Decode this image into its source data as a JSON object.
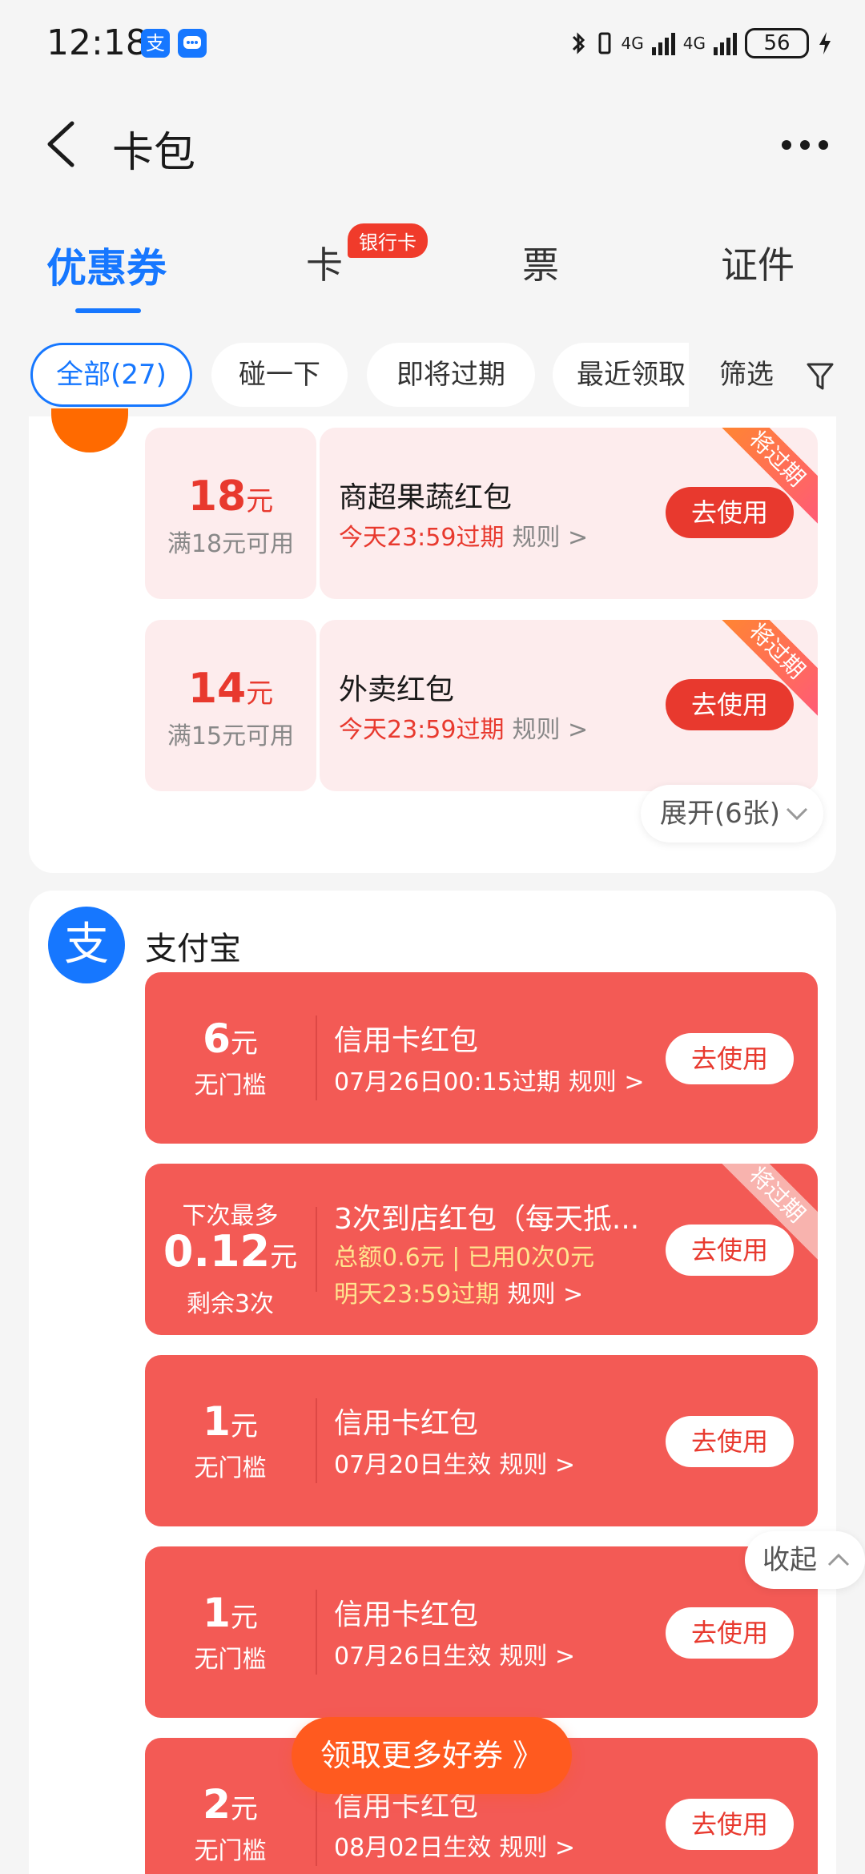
{
  "status_bar": {
    "time": "12:18",
    "app_icon_1": "支",
    "network_1": "4G",
    "network_2": "4G",
    "battery": "56"
  },
  "header": {
    "title": "卡包"
  },
  "tabs": [
    {
      "label": "优惠券",
      "active": true
    },
    {
      "label": "卡",
      "badge": "银行卡"
    },
    {
      "label": "票"
    },
    {
      "label": "证件"
    }
  ],
  "chips": [
    {
      "label": "全部(27)",
      "active": true
    },
    {
      "label": "碰一下"
    },
    {
      "label": "即将过期"
    },
    {
      "label": "最近领取"
    }
  ],
  "filter_label": "筛选",
  "group1": {
    "coupons": [
      {
        "amount": "18",
        "unit": "元",
        "condition": "满18元可用",
        "name": "商超果蔬红包",
        "expire": "今天23:59过期",
        "rule": "规则 >",
        "button": "去使用",
        "ribbon": "将过期"
      },
      {
        "amount": "14",
        "unit": "元",
        "condition": "满15元可用",
        "name": "外卖红包",
        "expire": "今天23:59过期",
        "rule": "规则 >",
        "button": "去使用",
        "ribbon": "将过期"
      }
    ],
    "expand_label": "展开(6张)"
  },
  "group2": {
    "logo": "支",
    "title": "支付宝",
    "coupons": [
      {
        "amount": "6",
        "unit": "元",
        "condition": "无门槛",
        "name": "信用卡红包",
        "expire": "07月26日00:15过期",
        "rule": "规则 >",
        "button": "去使用"
      },
      {
        "top": "下次最多",
        "amount": "0.12",
        "unit": "元",
        "bottom": "剩余3次",
        "name": "3次到店红包（每天抵...",
        "line2": "总额0.6元 | 已用0次0元",
        "expire": "明天23:59过期",
        "rule": "规则 >",
        "button": "去使用",
        "ribbon": "将过期"
      },
      {
        "amount": "1",
        "unit": "元",
        "condition": "无门槛",
        "name": "信用卡红包",
        "expire": "07月20日生效",
        "rule": "规则 >",
        "button": "去使用"
      },
      {
        "amount": "1",
        "unit": "元",
        "condition": "无门槛",
        "name": "信用卡红包",
        "expire": "07月26日生效",
        "rule": "规则 >",
        "button": "去使用"
      },
      {
        "amount": "2",
        "unit": "元",
        "condition": "无门槛",
        "name": "信用卡红包",
        "expire": "08月02日生效",
        "rule": "规则 >",
        "button": "去使用"
      }
    ],
    "collapse_label": "收起"
  },
  "more_coupons_label": "领取更多好券 》"
}
